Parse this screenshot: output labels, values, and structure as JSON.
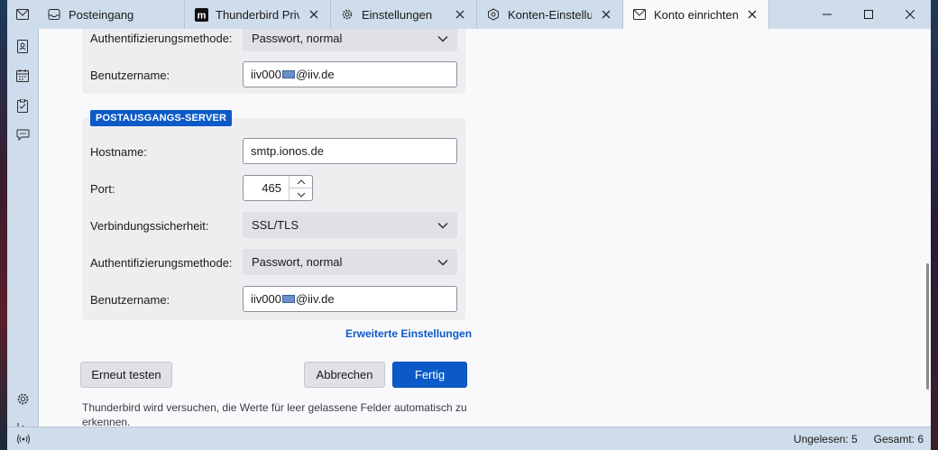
{
  "tabs": [
    {
      "label": "Posteingang",
      "icon": "inbox-icon"
    },
    {
      "label": "Thunderbird Privac",
      "icon": "m-logo-icon"
    },
    {
      "label": "Einstellungen",
      "icon": "gear-icon"
    },
    {
      "label": "Konten-Einstellung",
      "icon": "account-settings-icon"
    },
    {
      "label": "Konto einrichten",
      "icon": "mail-icon"
    }
  ],
  "incoming_partial": {
    "auth_label": "Authentifizierungsmethode:",
    "auth_value": "Passwort, normal",
    "user_label": "Benutzername:",
    "user_prefix": "iiv000",
    "user_suffix": "@iiv.de"
  },
  "outgoing": {
    "badge": "POSTAUSGANGS-SERVER",
    "host_label": "Hostname:",
    "host_value": "smtp.ionos.de",
    "port_label": "Port:",
    "port_value": "465",
    "security_label": "Verbindungssicherheit:",
    "security_value": "SSL/TLS",
    "auth_label": "Authentifizierungsmethode:",
    "auth_value": "Passwort, normal",
    "user_label": "Benutzername:",
    "user_prefix": "iiv000",
    "user_suffix": "@iiv.de"
  },
  "advanced_link": "Erweiterte Einstellungen",
  "buttons": {
    "retest": "Erneut testen",
    "cancel": "Abbrechen",
    "done": "Fertig"
  },
  "hint": "Thunderbird wird versuchen, die Werte für leer gelassene Felder automatisch zu erkennen.",
  "status": {
    "unread": "Ungelesen: 5",
    "total": "Gesamt: 6"
  },
  "colors": {
    "accent": "#0b5ac8",
    "chrome": "#cfdcec"
  }
}
